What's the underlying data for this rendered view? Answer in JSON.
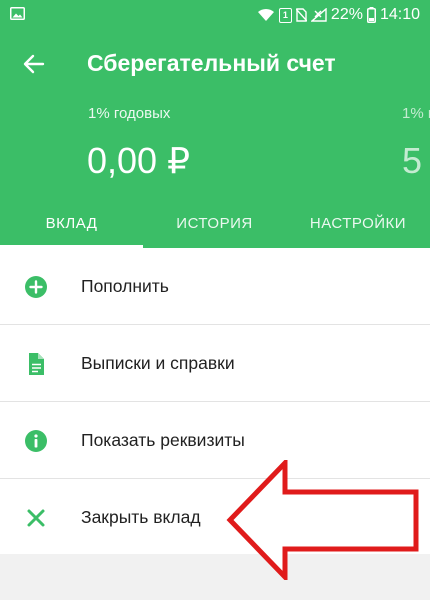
{
  "status_bar": {
    "icons": [
      "image-icon",
      "wifi-icon",
      "sim-icon",
      "no-sim-icon",
      "signal-icon",
      "battery-icon"
    ],
    "sim_badge": "1",
    "battery": "22%",
    "time": "14:10"
  },
  "header": {
    "title": "Сберегательный счет",
    "accounts": [
      {
        "rate": "1% годовых",
        "amount": "0,00 ₽"
      },
      {
        "rate": "1% г",
        "amount": "5"
      }
    ]
  },
  "tabs": [
    {
      "label": "ВКЛАД",
      "active": true
    },
    {
      "label": "ИСТОРИЯ",
      "active": false
    },
    {
      "label": "НАСТРОЙКИ",
      "active": false
    }
  ],
  "menu": [
    {
      "label": "Пополнить",
      "icon": "plus-circle-icon"
    },
    {
      "label": "Выписки и справки",
      "icon": "document-icon"
    },
    {
      "label": "Показать реквизиты",
      "icon": "info-icon"
    },
    {
      "label": "Закрыть вклад",
      "icon": "close-icon"
    }
  ],
  "colors": {
    "brand_green": "#3bbe67",
    "arrow_red": "#e01b1b"
  }
}
